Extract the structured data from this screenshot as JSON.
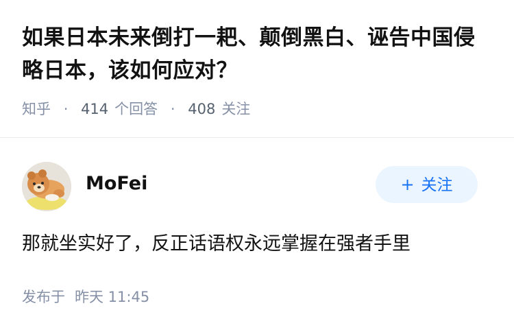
{
  "question": {
    "title": "如果日本未来倒打一耙、颠倒黑白、诬告中国侵略日本，该如何应对？",
    "source": "知乎",
    "answers_count": "414",
    "answers_label": "个回答",
    "followers_count": "408",
    "followers_label": "关注",
    "separator": "·"
  },
  "author": {
    "name": "MoFei",
    "avatar_icon": "bear-avatar-icon",
    "follow_label": "关注",
    "follow_icon": "+"
  },
  "answer": {
    "text": "那就坐实好了，反正话语权永远掌握在强者手里",
    "published_label": "发布于",
    "published_time": "昨天 11:45"
  },
  "colors": {
    "title": "#121212",
    "meta": "#8590a6",
    "accent": "#1772f6",
    "follow_bg": "#ebf5ff",
    "divider": "#ebebeb"
  }
}
